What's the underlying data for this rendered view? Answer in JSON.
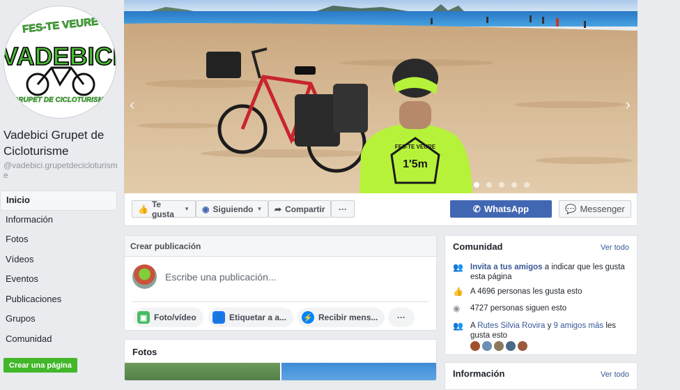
{
  "page": {
    "name": "Vadebici Grupet de Cicloturisme",
    "handle": "@vadebici.grupetdecicloturisme",
    "logo": {
      "top_text": "FES-TE VEURE",
      "main_text": "VADEBICI",
      "bottom_text": "GRUPET DE CICLOTURISME"
    }
  },
  "nav": {
    "items": [
      "Inicio",
      "Información",
      "Fotos",
      "Vídeos",
      "Eventos",
      "Publicaciones",
      "Grupos",
      "Comunidad"
    ],
    "active": "Inicio",
    "create_page": "Crear una página"
  },
  "cover": {
    "slides": 5,
    "active_slide": 1,
    "shirt_text": {
      "top": "FES-TE VEURE",
      "main": "1'5m"
    }
  },
  "actions": {
    "like": "Te gusta",
    "following": "Siguiendo",
    "share": "Compartir",
    "more": "···",
    "whatsapp": "WhatsApp",
    "messenger": "Messenger"
  },
  "composer": {
    "header": "Crear publicación",
    "placeholder": "Escribe una publicación...",
    "photo": "Foto/vídeo",
    "tag": "Etiquetar a a...",
    "message": "Recibir mens...",
    "more": "···"
  },
  "photos": {
    "title": "Fotos"
  },
  "community": {
    "title": "Comunidad",
    "see_all": "Ver todo",
    "invite_link": "Invita a tus amigos",
    "invite_rest": " a indicar que les gusta esta página",
    "likes": "A 4696 personas les gusta esto",
    "follows": "4727 personas siguen esto",
    "friends_prefix": "A ",
    "friends_names": "Rutes Silvia Rovira",
    "friends_mid": " y ",
    "friends_more": "9 amigos más",
    "friends_suffix": " les gusta esto"
  },
  "info": {
    "title": "Información",
    "see_all": "Ver todo"
  },
  "colors": {
    "fb_blue": "#4267b2",
    "link": "#385898",
    "green": "#42b72a",
    "neon": "#b6f23a"
  }
}
